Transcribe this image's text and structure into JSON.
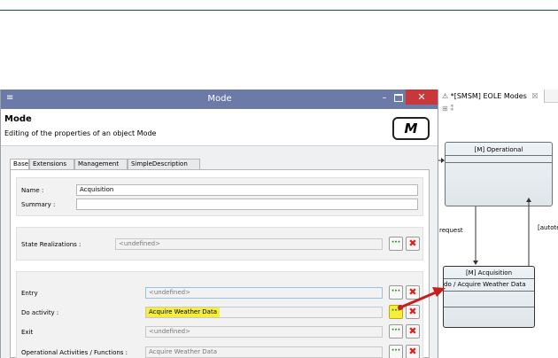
{
  "dialog": {
    "window_title": "Mode",
    "header_title": "Mode",
    "header_subtitle": "Editing of the properties of an object Mode",
    "logo": "M",
    "tabs": [
      {
        "label": "Base",
        "active": true
      },
      {
        "label": "Extensions",
        "active": false
      },
      {
        "label": "Management",
        "active": false
      },
      {
        "label": "SimpleDescription",
        "active": false
      }
    ],
    "name_label": "Name :",
    "name_value": "Acquisition",
    "summary_label": "Summary :",
    "summary_value": "",
    "state_realizations_label": "State Realizations :",
    "state_realizations_value": "<undefined>",
    "entry_label": "Entry",
    "entry_value": "<undefined>",
    "do_activity_label": "Do activity :",
    "do_activity_value": "Acquire Weather Data",
    "exit_label": "Exit",
    "exit_value": "<undefined>",
    "op_activities_label": "Operational Activities / Functions :",
    "op_activities_value": "Acquire Weather Data",
    "browse_glyph": "···",
    "delete_glyph": "✖",
    "highlight_color": "#f6ee3e"
  },
  "diagram": {
    "tab_label": "*[SMSM] EOLE Modes",
    "tab_close": "☒",
    "operational_state": "[M] Operational",
    "acquisition_state": "[M] Acquisition",
    "acquisition_activity": "do / Acquire Weather Data",
    "edge_request": "request",
    "edge_autote": "[autote"
  },
  "colors": {
    "titlebar": "#6c7aa8",
    "close_button": "#c8373a",
    "arrow": "#c81e1e"
  }
}
